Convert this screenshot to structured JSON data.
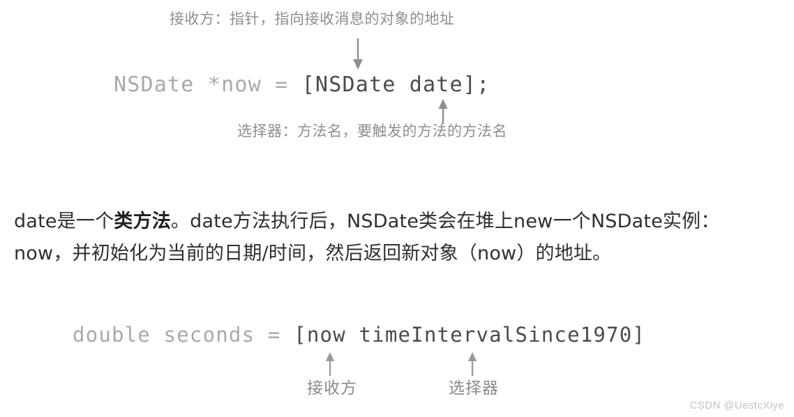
{
  "background_color": "#ffffff",
  "figure_top": {
    "caption_receiver": "接收方：指针，指向接收消息的对象的地址",
    "caption_selector": "选择器：方法名，要触发的方法的方法名",
    "code": {
      "dim_part": "NSDate *now = ",
      "strong_part": "[NSDate date];"
    },
    "arrow_down_label": "arrow-down-to-code",
    "arrow_up_label": "arrow-up-to-selector"
  },
  "paragraph": {
    "segment_1": "date是一个",
    "segment_bold": "类方法",
    "segment_2": "。date方法执行后，NSDate类会在堆上new一个NSDate实例：now，并初始化为当前的日期/时间，然后返回新对象（now）的地址。"
  },
  "figure_bottom": {
    "code": {
      "dim_part": "double seconds = ",
      "strong_part": "[now timeIntervalSince1970]"
    },
    "label_receiver": "接收方",
    "label_selector": "选择器"
  },
  "watermark": {
    "text": "CSDN @UestcXiye"
  },
  "colors": {
    "code_dim": "#a9a9a9",
    "code_strong": "#4b4b4b",
    "caption": "#8e8e8e",
    "body_text": "#2f2f2f",
    "watermark": "#c2c2c2"
  }
}
